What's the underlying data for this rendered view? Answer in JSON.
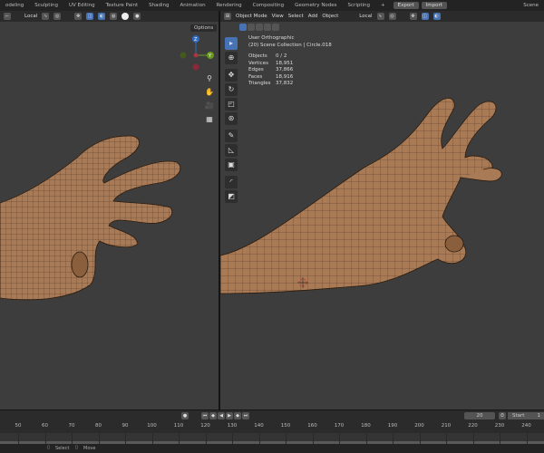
{
  "workspaces": [
    "odeling",
    "Sculpting",
    "UV Editing",
    "Texture Paint",
    "Shading",
    "Animation",
    "Rendering",
    "Compositing",
    "Geometry Nodes",
    "Scripting"
  ],
  "topbar": {
    "add": "+",
    "export": "Export",
    "import": "Import",
    "scene": "Scene"
  },
  "left_header": {
    "orientation": "Local",
    "options": "Options"
  },
  "right_header": {
    "mode": "Object Mode",
    "menus": [
      "View",
      "Select",
      "Add",
      "Object"
    ],
    "orientation": "Local"
  },
  "overlay": {
    "view": "User Orthographic",
    "collection": "(20) Scene Collection | Circle.018",
    "stats": [
      {
        "label": "Objects",
        "value": "0 / 2"
      },
      {
        "label": "Vertices",
        "value": "18,951"
      },
      {
        "label": "Edges",
        "value": "37,866"
      },
      {
        "label": "Faces",
        "value": "18,916"
      },
      {
        "label": "Triangles",
        "value": "37,832"
      }
    ]
  },
  "gizmo": {
    "z": "Z",
    "y": "Y",
    "x": "X"
  },
  "timeline": {
    "current_frame": "20",
    "start_label": "Start",
    "start": "1",
    "ticks": [
      "50",
      "60",
      "70",
      "80",
      "90",
      "100",
      "110",
      "120",
      "130",
      "140",
      "150",
      "160",
      "170",
      "180",
      "190",
      "200",
      "210",
      "220",
      "230",
      "240"
    ]
  },
  "status": {
    "select": "Select",
    "move": "Move"
  },
  "colors": {
    "accent": "#4772b3",
    "skin": "#a87a56",
    "background": "#3d3d3d"
  }
}
